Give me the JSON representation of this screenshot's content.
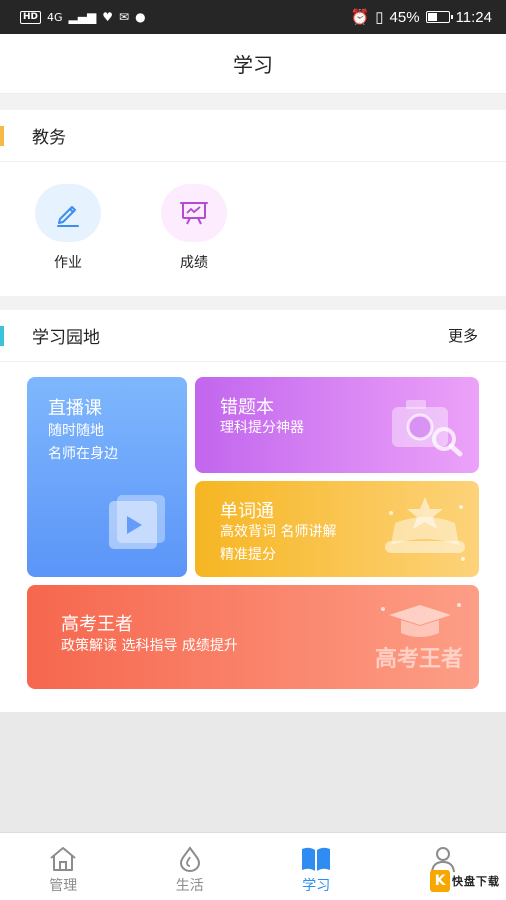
{
  "status_bar": {
    "left_hd": "HD",
    "left_net": "4G",
    "battery_percent": "45%",
    "battery_level": 0.45,
    "time": "11:24"
  },
  "header": {
    "title": "学习"
  },
  "section_jiaowu": {
    "title": "教务",
    "accent_color": "#f5b945",
    "items": [
      {
        "label": "作业",
        "icon": "pencil-icon",
        "bg": "#e6f2fe"
      },
      {
        "label": "成绩",
        "icon": "presentation-chart-icon",
        "bg": "#fcecfd"
      }
    ]
  },
  "section_garden": {
    "title": "学习园地",
    "more": "更多",
    "accent_color": "#39c2d8",
    "cards": {
      "live": {
        "title": "直播课",
        "lines": [
          "随时随地",
          "名师在身边"
        ],
        "icon": "video-play-icon"
      },
      "wrong": {
        "title": "错题本",
        "sub": "理科提分神器",
        "icon": "camera-search-icon"
      },
      "word": {
        "title": "单词通",
        "lines": [
          "高效背词  名师讲解",
          "精准提分"
        ],
        "icon": "badge-star-icon"
      },
      "gaokao": {
        "title": "高考王者",
        "sub": "政策解读  选科指导  成绩提升",
        "icon": "graduation-cap-icon",
        "deco_text": "高考王者"
      }
    }
  },
  "tabbar": {
    "tabs": [
      {
        "label": "管理",
        "icon": "home-icon"
      },
      {
        "label": "生活",
        "icon": "drop-icon"
      },
      {
        "label": "学习",
        "icon": "book-icon",
        "active": true
      },
      {
        "label": "",
        "icon": "user-icon"
      }
    ],
    "watermark": {
      "mark": "K",
      "text": "快盘下载"
    }
  }
}
